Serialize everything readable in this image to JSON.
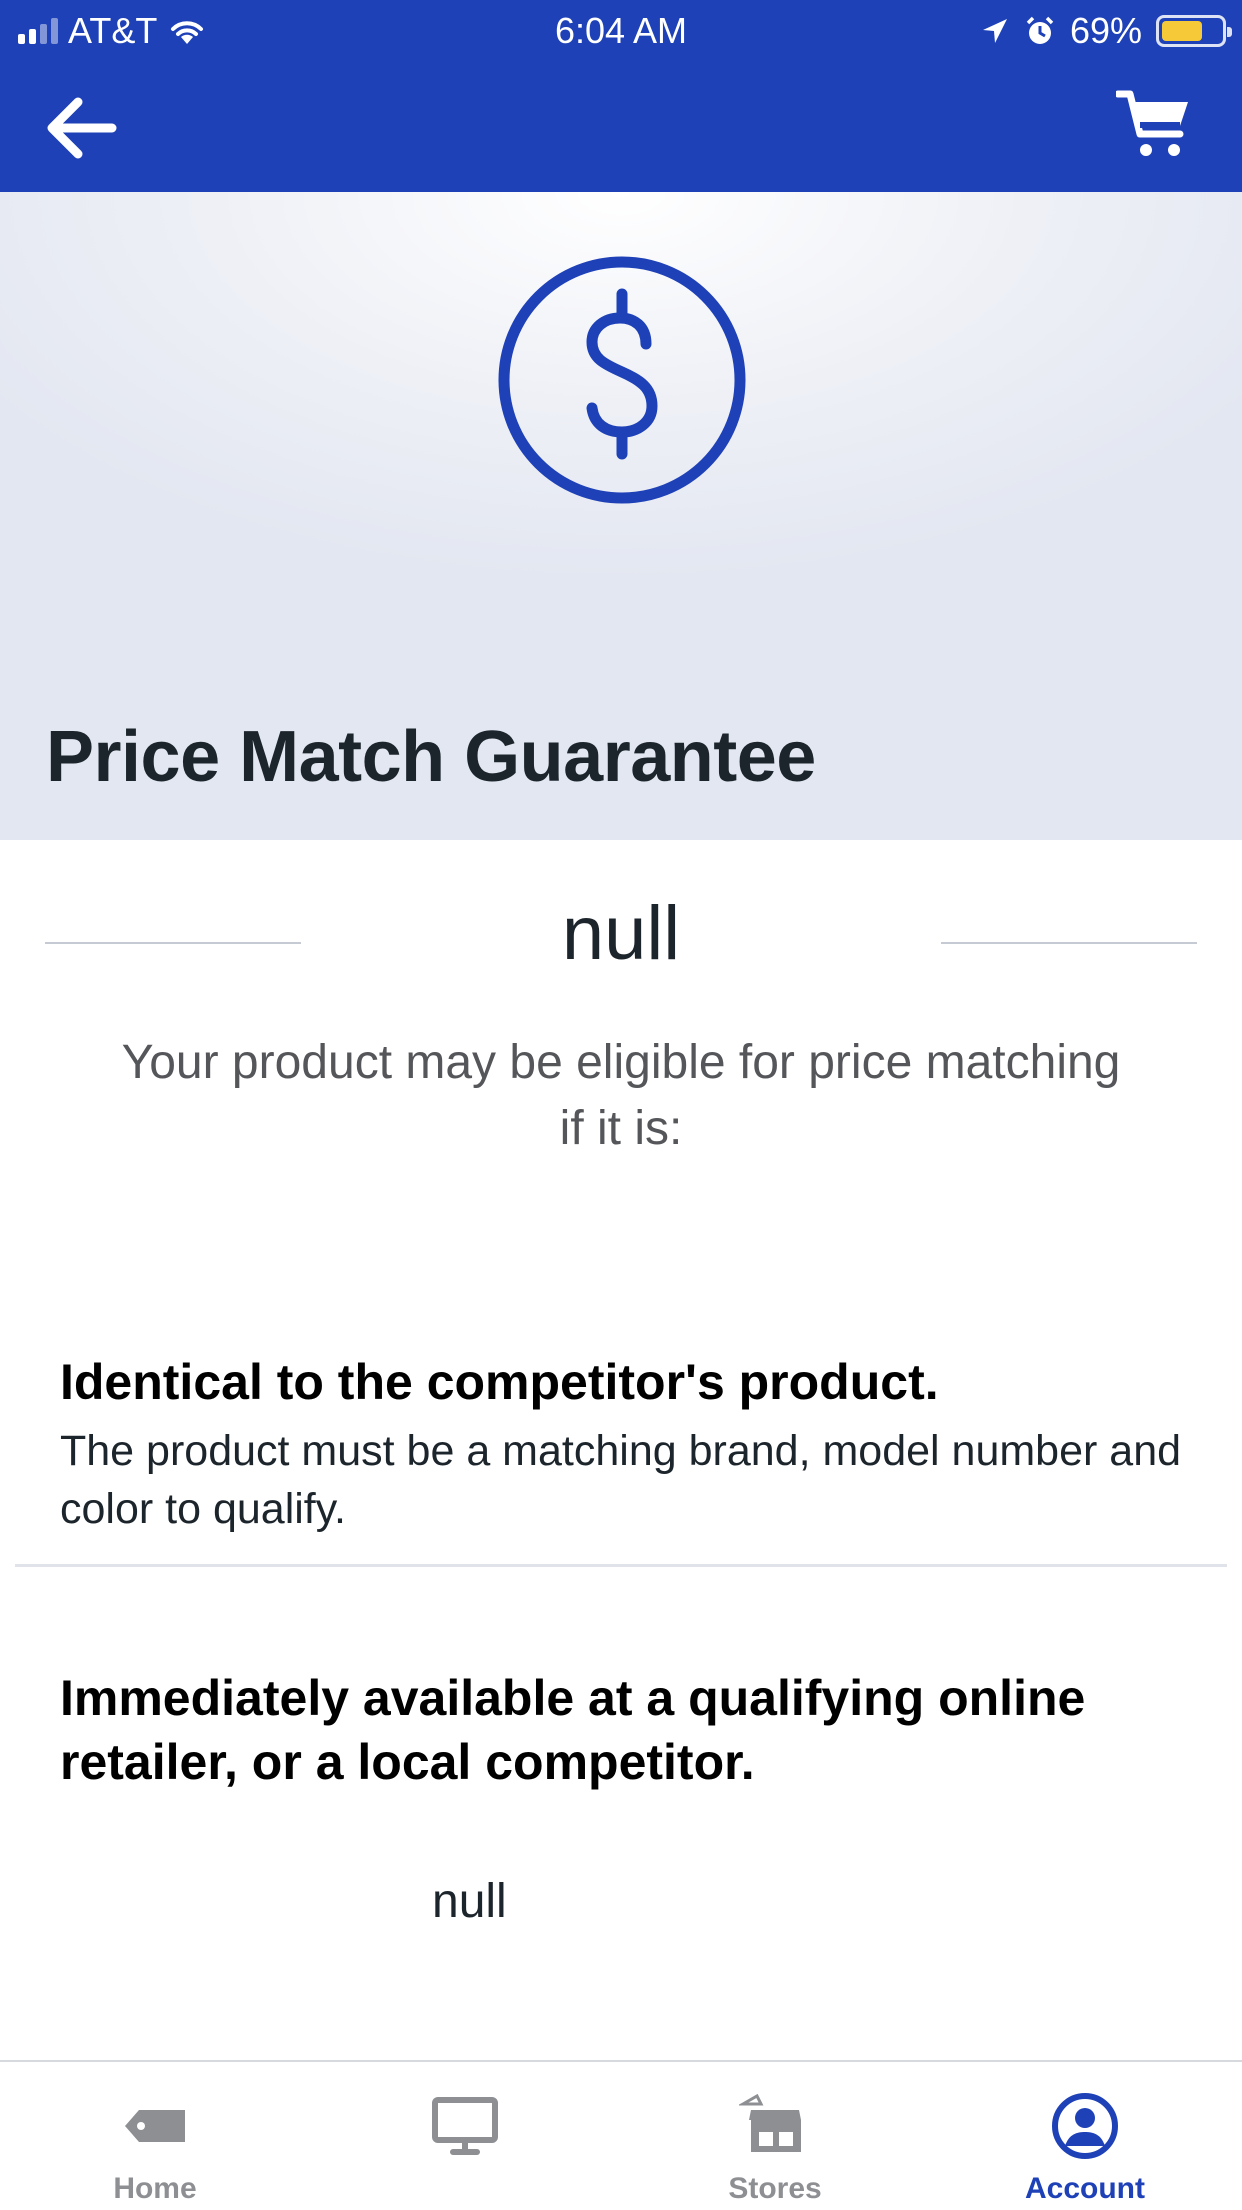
{
  "status_bar": {
    "carrier": "AT&T",
    "time": "6:04 AM",
    "battery_percent": "69%",
    "battery_level": 0.69,
    "icons": [
      "signal-icon",
      "wifi-icon",
      "location-icon",
      "alarm-icon",
      "battery-icon"
    ]
  },
  "nav": {
    "back_icon": "back-arrow-icon",
    "cart_icon": "cart-icon"
  },
  "hero": {
    "icon": "dollar-circle-icon",
    "title": "Price Match Guarantee"
  },
  "section": {
    "heading": "null",
    "intro": "Your product may be eligible for price matching if it is:"
  },
  "criteria": [
    {
      "title": "Identical to the competitor's product.",
      "description": "The product must be a matching brand, model number and color to qualify."
    },
    {
      "title": "Immediately available at a qualifying online retailer, or a local competitor.",
      "description": "null"
    }
  ],
  "tabs": [
    {
      "label": "Home",
      "icon": "tag-icon",
      "active": false
    },
    {
      "label": "",
      "icon": "monitor-icon",
      "active": false
    },
    {
      "label": "Stores",
      "icon": "store-icon",
      "active": false
    },
    {
      "label": "Account",
      "icon": "account-icon",
      "active": true
    }
  ],
  "colors": {
    "brand_blue": "#1e41b7",
    "battery_yellow": "#f5c937",
    "inactive_tab": "#8d8f93"
  }
}
